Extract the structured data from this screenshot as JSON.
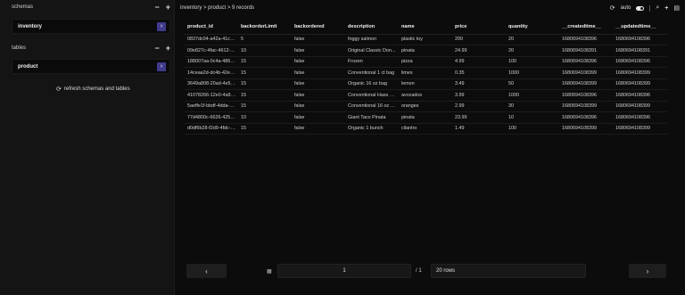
{
  "sidebar": {
    "schemas_label": "schemas",
    "schemas": [
      {
        "name": "inventory"
      }
    ],
    "tables_label": "tables",
    "tables": [
      {
        "name": "product"
      }
    ],
    "minus_glyph": "−",
    "plus_glyph": "+",
    "go_glyph": "›",
    "refresh_label": "refresh schemas and tables",
    "refresh_icon": "refresh-icon"
  },
  "header": {
    "breadcrumb": "inventory > product > 9 records",
    "refresh_mode": "auto",
    "icons": [
      "refresh-icon",
      "toggle-icon",
      "search-icon",
      "add-icon",
      "save-icon"
    ]
  },
  "table": {
    "columns": [
      "product_id",
      "backorderLimit",
      "backordered",
      "description",
      "name",
      "price",
      "quantity",
      "__createdtime__",
      "__updatedtime__"
    ],
    "rows": [
      [
        "0837dc04-a42a-41c8...",
        "5",
        "false",
        "foggy salmon",
        "plastic toy",
        "200",
        "20",
        "1680694108396",
        "1680694108396"
      ],
      [
        "09e827c-4fac-4612-...",
        "10",
        "false",
        "Original Classic Don...",
        "pinata",
        "24.99",
        "20",
        "1680694108391",
        "1680694108391"
      ],
      [
        "188007aa-0c4a-486a...",
        "15",
        "false",
        "Frozen",
        "pizza",
        "4.99",
        "100",
        "1680694108396",
        "1680694108396"
      ],
      [
        "14ceaa2d-dc4b-42e3...",
        "15",
        "false",
        "Conventional 1 ct bag",
        "limes",
        "0.35",
        "1000",
        "1680694108399",
        "1680694108399"
      ],
      [
        "3649a808-20ad-4e58...",
        "15",
        "false",
        "Organic 16 oz bag",
        "lemon",
        "3.49",
        "50",
        "1680694108399",
        "1680694108399"
      ],
      [
        "41078266-12e0-4a91...",
        "15",
        "false",
        "Conventional Hass 4...",
        "avocados",
        "3.99",
        "1000",
        "1680694108396",
        "1680694108396"
      ],
      [
        "5aeffe1f-bbdf-4dda-8...",
        "15",
        "false",
        "Conventional 16 oz bag",
        "oranges",
        "2.99",
        "30",
        "1680694108399",
        "1680694108399"
      ],
      [
        "77d4800c-6626-4251...",
        "10",
        "false",
        "Giant Taco Pinata",
        "pinata",
        "23.99",
        "10",
        "1680694108396",
        "1680694108396"
      ],
      [
        "d0df6b28-f2d9-4fdc-8...",
        "15",
        "false",
        "Organic 1 bunch",
        "cilantro",
        "1.49",
        "100",
        "1680694108399",
        "1680694108399"
      ]
    ]
  },
  "pagination": {
    "prev_glyph": "‹",
    "next_glyph": "›",
    "page": "1",
    "of_label": "/ 1",
    "rows_label": "20 rows",
    "page_icon": "page-icon"
  }
}
